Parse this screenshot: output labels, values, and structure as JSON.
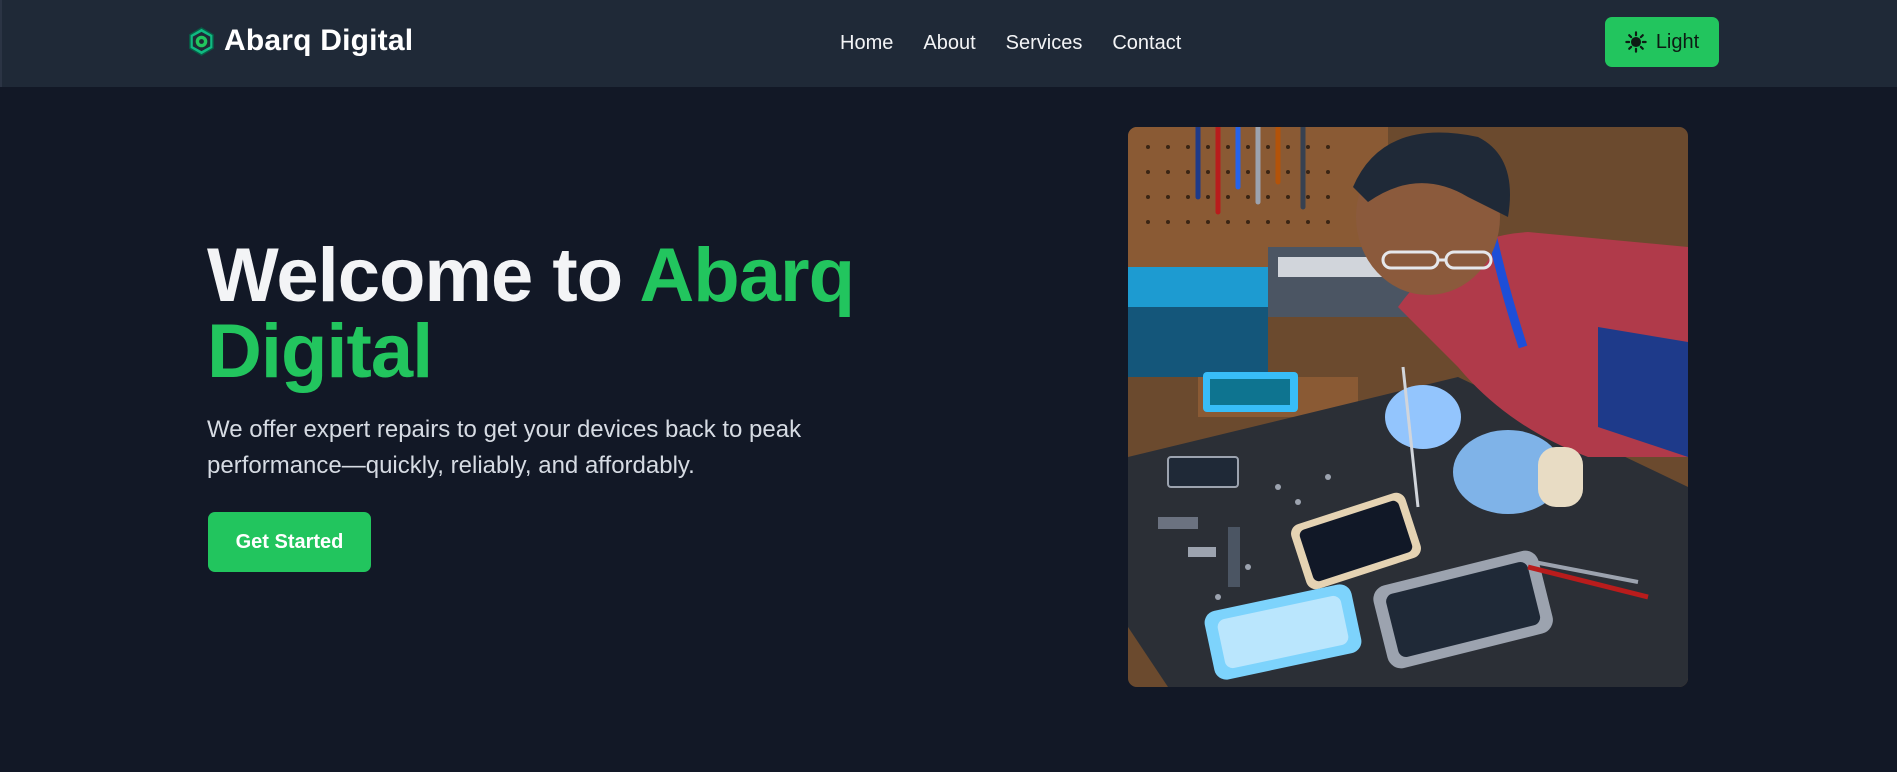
{
  "navbar": {
    "brand_name": "Abarq Digital",
    "links": [
      "Home",
      "About",
      "Services",
      "Contact"
    ],
    "theme_toggle_label": "Light"
  },
  "hero": {
    "title_prefix": "Welcome to ",
    "title_accent": "Abarq Digital",
    "description": "We offer expert repairs to get your devices back to peak performance—quickly, reliably, and affordably.",
    "cta_label": "Get Started",
    "image_subject": "technician repairing smartphones at a workbench"
  },
  "colors": {
    "page_background": "#121826",
    "navbar_background": "#1f2937",
    "accent": "#22c55e",
    "heading_text": "#f3f4f6",
    "body_text": "#d6dbe3"
  },
  "icons": {
    "brand_logo": "gear-hexagon-icon",
    "theme_toggle": "sun-icon"
  }
}
